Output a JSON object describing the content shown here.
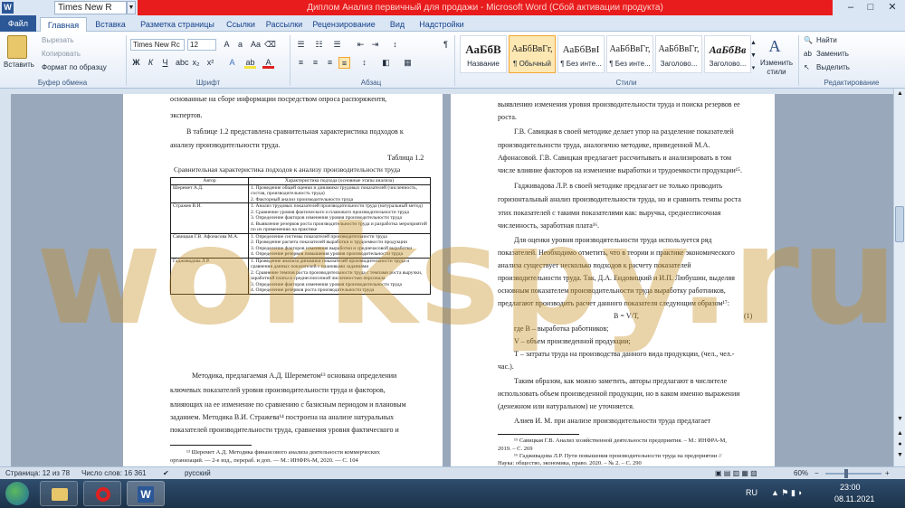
{
  "titlebar": {
    "app_icon": "W",
    "font_combo": "Times New R",
    "title": "Диплом Анализ первичный для продажи  -  Microsoft Word (Сбой активации продукта)"
  },
  "tabs": [
    "Файл",
    "Главная",
    "Вставка",
    "Разметка страницы",
    "Ссылки",
    "Рассылки",
    "Рецензирование",
    "Вид",
    "Надстройки"
  ],
  "ribbon": {
    "clipboard": {
      "paste": "Вставить",
      "cut": "Вырезать",
      "copy": "Копировать",
      "format_painter": "Формат по образцу",
      "label": "Буфер обмена"
    },
    "font": {
      "name": "Times New Rc",
      "size": "12",
      "bold": "Ж",
      "italic": "К",
      "underline": "Ч",
      "label": "Шрифт"
    },
    "paragraph": {
      "label": "Абзац",
      "pilcrow": "¶"
    },
    "styles": {
      "label": "Стили",
      "items": [
        {
          "sample": "АаБбВ",
          "name": "Название"
        },
        {
          "sample": "АаБбВвГг,",
          "name": "¶ Обычный"
        },
        {
          "sample": "АаБбВвІ",
          "name": "¶ Без инте..."
        },
        {
          "sample": "АаБбВвГг,",
          "name": "¶ Без инте..."
        },
        {
          "sample": "АаБбВвГг,",
          "name": "Заголово..."
        },
        {
          "sample": "АаБбВв",
          "name": "Заголово..."
        }
      ],
      "change": "Изменить стили"
    },
    "editing": {
      "find": "Найти",
      "replace": "Заменить",
      "select": "Выделить",
      "label": "Редактирование"
    }
  },
  "page_left": {
    "lines": [
      "основанные   на   сборе   информации   посредством   опроса   распоряжентя,",
      "экспертов.",
      "В  таблице  1.2  представлена  сравнительная  характеристика  подходов  к",
      "анализу производительности труда.",
      "Таблица 1.2",
      "Сравнительная характеристика подходов к анализу производительности труда"
    ],
    "table": {
      "headers": [
        "Автор",
        "Характеристика подхода (основные этапы анализа)"
      ],
      "rows": [
        [
          "Шеремет А.Д.",
          "1. Проведение общей оценки и динамики трудовых показателей (численность, состав, производительность труда)\n2. Факторный анализ производительности труда"
        ],
        [
          "Стражев В.И.",
          "1. Анализ трудовых показателей производительности труда (натуральный метод)\n2. Сравнение уровня фактического и планового производительности труда\n3. Определение факторов изменения уровня производительности труда\n4. Выявление резервов роста производительности труда и разработка мероприятий по их применению на практике"
        ],
        [
          "Савицкая Г.В. Афонасова М.А.",
          "1. Определение системы показателей производительности труда\n2. Проведение расчета показателей выработки и трудоемкости продукции\n3. Определение факторов изменения выработки и среднечасовой выработки\n4. Определение резервов повышения уровня производительности труда"
        ],
        [
          "Гадживадова Л.Р.",
          "1. Проведение анализа динамики показателей производительности труда и сравнения данных показателей с плановыми заданиями\n2. Сравнение темпов роста производительности труда с темпами роста выручки, заработной платы и среднесписочной численностью персонала\n3. Определение факторов изменения уровня производительности труда\n4. Определение резервов роста производительности труда"
        ]
      ]
    },
    "after": [
      "Методика,  предлагаемая  А.Д.  Шереметом¹³  основана  определении",
      "ключевых   показателей   уровня   производительности   труда   и   факторов,",
      "влияющих  на  ее  изменение  по  сравнению  с  базисным  периодом  и  плановым",
      "заданием.  Методика  В.И.  Стражева¹⁴  построена  на  анализе  натуральных",
      "показателей   производительности   труда,   сравнения   уровня   фактического   и"
    ],
    "footnotes": [
      "¹³  Шеремет  А.Д.  Методика  финансового  анализа  деятельности  коммерческих",
      "организаций.  — 2-е изд., перераб. и доп. — М.: ИНФРА-М, 2020. — С. 104"
    ]
  },
  "page_right": {
    "lines": [
      "выявлению изменения уровня производительности труда и поиска резервов ее",
      "роста.",
      "Г.В.  Савицкая  в  своей  методике  делает  упор  на  разделение  показателей",
      "производительности   труда,   аналогично   методике,   приведенной   М.А.",
      "Афонасовой.  Г.В.  Савицкая  предлагает  рассчитывать  и  анализировать  в  том",
      "числе влияние факторов на изменение выработки и трудоемкости продукции¹⁵.",
      "Гадживадова  Л.Р.  в  своей  методике  предлагает  не  только  проводить",
      "горизонтальный анализ производительности труда, но и сравнить темпы роста",
      "этих   показателей   с   такими   показателями   как:   выручка,   среднесписочная",
      "численность, заработная плата¹⁶.",
      "Для   оценки   уровня   производительности   труда   используется   ряд",
      "показателей.  Необходимо  отметить,  что  в  теории  и  практике  экономического",
      "анализа   существует   несколько   подходов   к   расчету   показателей",
      "производительности  труда.  Так,  Д.А.  Ендовицкий  и  И.П.  Любушин,  выделяя",
      "основным   показателем   производительности   труда   выработку   работников,",
      "предлагают производить расчет данного показателя следующим образом¹⁷:",
      "В = V/Т,",
      "(1)",
      "где В – выработка работников;",
      "V – объем произведенной продукции;",
      "Т – затраты труда на производства данного вида продукции, (чел., чел.-",
      "час.).",
      "Таким образом, как можно заметить, авторы предлагают в числителе",
      "использовать объем произведенной продукции, но в каком именно выражении",
      "(денежном или натуральном) не уточняется.",
      "Алиев   И. М.   при   анализе   производительности   труда   предлагает"
    ],
    "footnotes": [
      "¹⁵ Савицкая Г.В. Анализ хозяйственной деятельности предприятия. – М.: ИНФРА-М,",
      "2019. – С. 269",
      "¹⁶  Гадживадова Л.Р. Пути повышения производительности труда на предприятии //",
      "Наука: общество, экономика, право. 2020. – № 2. – С. 290"
    ]
  },
  "watermark": "workspy.ru",
  "status": {
    "page": "Страница: 12 из 78",
    "words": "Число слов: 16 361",
    "lang": "русский",
    "zoom": "60%"
  },
  "taskbar": {
    "lang": "RU",
    "time": "23:00",
    "date": "08.11.2021"
  }
}
